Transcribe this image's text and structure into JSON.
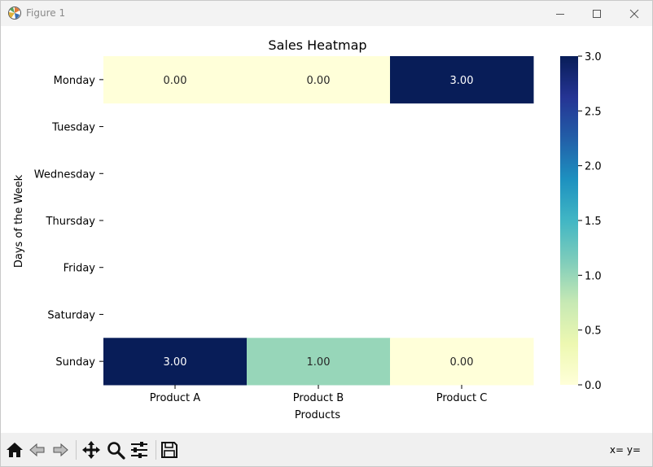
{
  "window": {
    "title": "Figure 1"
  },
  "toolbar": {
    "buttons": [
      {
        "name": "home-icon"
      },
      {
        "name": "back-arrow-icon"
      },
      {
        "name": "forward-arrow-icon"
      },
      {
        "name": "pan-icon"
      },
      {
        "name": "zoom-icon"
      },
      {
        "name": "configure-subplots-icon"
      },
      {
        "name": "save-icon"
      }
    ],
    "coords_text": "x= y="
  },
  "chart_data": {
    "type": "heatmap",
    "title": "Sales Heatmap",
    "xlabel": "Products",
    "ylabel": "Days of the Week",
    "x_categories": [
      "Product A",
      "Product B",
      "Product C"
    ],
    "y_categories": [
      "Monday",
      "Tuesday",
      "Wednesday",
      "Thursday",
      "Friday",
      "Saturday",
      "Sunday"
    ],
    "values": [
      [
        0,
        0,
        3
      ],
      [
        null,
        null,
        null
      ],
      [
        null,
        null,
        null
      ],
      [
        null,
        null,
        null
      ],
      [
        null,
        null,
        null
      ],
      [
        null,
        null,
        null
      ],
      [
        3,
        1,
        0
      ]
    ],
    "cell_labels": [
      [
        "0.00",
        "0.00",
        "3.00"
      ],
      [
        "",
        "",
        ""
      ],
      [
        "",
        "",
        ""
      ],
      [
        "",
        "",
        ""
      ],
      [
        "",
        "",
        ""
      ],
      [
        "",
        "",
        ""
      ],
      [
        "3.00",
        "1.00",
        "0.00"
      ]
    ],
    "colormap": "YlGnBu",
    "colormap_stops": [
      "#ffffd9",
      "#edf8b1",
      "#c7e9b4",
      "#7fcdbb",
      "#41b6c4",
      "#1d91c0",
      "#225ea8",
      "#253494",
      "#081d58"
    ],
    "vmin": 0,
    "vmax": 3,
    "colorbar_ticks": [
      "0.0",
      "0.5",
      "1.0",
      "1.5",
      "2.0",
      "2.5",
      "3.0"
    ],
    "colorbar_tick_values": [
      0,
      0.5,
      1,
      1.5,
      2,
      2.5,
      3
    ]
  }
}
